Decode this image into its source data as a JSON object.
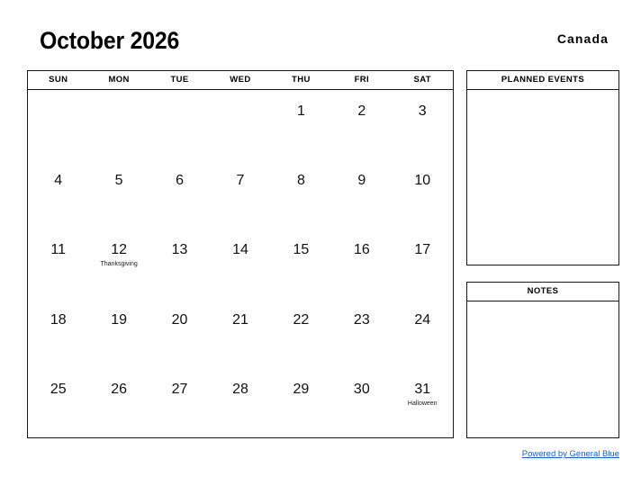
{
  "header": {
    "title": "October 2026",
    "country": "Canada"
  },
  "calendar": {
    "weekdays": [
      "SUN",
      "MON",
      "TUE",
      "WED",
      "THU",
      "FRI",
      "SAT"
    ],
    "weeks": [
      [
        {
          "day": ""
        },
        {
          "day": ""
        },
        {
          "day": ""
        },
        {
          "day": ""
        },
        {
          "day": "1"
        },
        {
          "day": "2"
        },
        {
          "day": "3"
        }
      ],
      [
        {
          "day": "4"
        },
        {
          "day": "5"
        },
        {
          "day": "6"
        },
        {
          "day": "7"
        },
        {
          "day": "8"
        },
        {
          "day": "9"
        },
        {
          "day": "10"
        }
      ],
      [
        {
          "day": "11"
        },
        {
          "day": "12",
          "event": "Thanksgiving"
        },
        {
          "day": "13"
        },
        {
          "day": "14"
        },
        {
          "day": "15"
        },
        {
          "day": "16"
        },
        {
          "day": "17"
        }
      ],
      [
        {
          "day": "18"
        },
        {
          "day": "19"
        },
        {
          "day": "20"
        },
        {
          "day": "21"
        },
        {
          "day": "22"
        },
        {
          "day": "23"
        },
        {
          "day": "24"
        }
      ],
      [
        {
          "day": "25"
        },
        {
          "day": "26"
        },
        {
          "day": "27"
        },
        {
          "day": "28"
        },
        {
          "day": "29"
        },
        {
          "day": "30"
        },
        {
          "day": "31",
          "event": "Halloween"
        }
      ]
    ]
  },
  "panels": {
    "planned_events": {
      "title": "PLANNED EVENTS",
      "content": ""
    },
    "notes": {
      "title": "NOTES",
      "content": ""
    }
  },
  "footer": {
    "link_text": "Powered by General Blue"
  },
  "colors": {
    "border": "#1a1a1a",
    "text": "#000000",
    "link": "#1a5fd4",
    "background": "#ffffff"
  }
}
